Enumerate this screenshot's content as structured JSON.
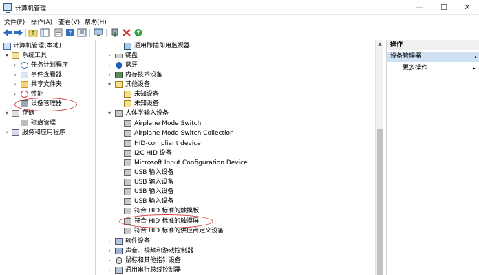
{
  "window": {
    "title": "计算机管理",
    "minimize_glyph": "—",
    "maximize_glyph": "☐",
    "close_glyph": "✕"
  },
  "menu": [
    "文件(F)",
    "操作(A)",
    "查看(V)",
    "帮助(H)"
  ],
  "toolbar_icons": [
    "back-icon",
    "forward-icon",
    "up-folder-icon",
    "show-hide-tree-icon",
    "properties-icon",
    "help-icon",
    "help-book-icon",
    "monitor-icon",
    "update-driver-icon",
    "delete-icon",
    "enable-device-icon"
  ],
  "left_tree": [
    {
      "label": "计算机管理(本地)",
      "icon": "computer-icon",
      "arrow": "",
      "indent": 0
    },
    {
      "label": "系统工具",
      "icon": "tools-icon",
      "arrow": "▾",
      "indent": 1
    },
    {
      "label": "任务计划程序",
      "icon": "clock-icon",
      "arrow": "›",
      "indent": 2
    },
    {
      "label": "事件查看器",
      "icon": "log-icon",
      "arrow": "›",
      "indent": 2
    },
    {
      "label": "共享文件夹",
      "icon": "folder-icon",
      "arrow": "›",
      "indent": 2
    },
    {
      "label": "性能",
      "icon": "performance-icon",
      "arrow": "›",
      "indent": 2
    },
    {
      "label": "设备管理器",
      "icon": "device-manager-icon",
      "arrow": "",
      "indent": 2
    },
    {
      "label": "存储",
      "icon": "storage-icon",
      "arrow": "▾",
      "indent": 1
    },
    {
      "label": "磁盘管理",
      "icon": "disk-icon",
      "arrow": "",
      "indent": 2
    },
    {
      "label": "服务和应用程序",
      "icon": "services-icon",
      "arrow": "›",
      "indent": 1
    }
  ],
  "device_tree": [
    {
      "label": "通用即插即用监视器",
      "icon": "monitor-icon",
      "arrow": "",
      "level": 2
    },
    {
      "label": "键盘",
      "icon": "keyboard-icon",
      "arrow": "›",
      "level": 1
    },
    {
      "label": "蓝牙",
      "icon": "bluetooth-icon",
      "arrow": "›",
      "level": 1
    },
    {
      "label": "内存技术设备",
      "icon": "chip-icon",
      "arrow": "›",
      "level": 1
    },
    {
      "label": "其他设备",
      "icon": "unknown-device-icon",
      "arrow": "▾",
      "level": 1
    },
    {
      "label": "未知设备",
      "icon": "unknown-device-icon",
      "arrow": "",
      "level": 2
    },
    {
      "label": "未知设备",
      "icon": "unknown-device-icon",
      "arrow": "",
      "level": 2
    },
    {
      "label": "人体学输入设备",
      "icon": "hid-icon",
      "arrow": "▾",
      "level": 1
    },
    {
      "label": "Airplane Mode Switch",
      "icon": "hid-icon",
      "arrow": "",
      "level": 2
    },
    {
      "label": "Airplane Mode Switch Collection",
      "icon": "hid-icon",
      "arrow": "",
      "level": 2
    },
    {
      "label": "HID-compliant device",
      "icon": "hid-icon",
      "arrow": "",
      "level": 2
    },
    {
      "label": "I2C HID 设备",
      "icon": "hid-icon",
      "arrow": "",
      "level": 2
    },
    {
      "label": "Microsoft Input Configuration Device",
      "icon": "hid-icon",
      "arrow": "",
      "level": 2
    },
    {
      "label": "USB 输入设备",
      "icon": "hid-icon",
      "arrow": "",
      "level": 2
    },
    {
      "label": "USB 输入设备",
      "icon": "hid-icon",
      "arrow": "",
      "level": 2
    },
    {
      "label": "USB 输入设备",
      "icon": "hid-icon",
      "arrow": "",
      "level": 2
    },
    {
      "label": "USB 输入设备",
      "icon": "hid-icon",
      "arrow": "",
      "level": 2
    },
    {
      "label": "符合 HID 标准的触摸板",
      "icon": "hid-icon",
      "arrow": "",
      "level": 2
    },
    {
      "label": "符合 HID 标准的触摸屏",
      "icon": "hid-icon",
      "arrow": "",
      "level": 2
    },
    {
      "label": "符合 HID 标准的供应商定义设备",
      "icon": "hid-icon",
      "arrow": "",
      "level": 2
    },
    {
      "label": "软件设备",
      "icon": "software-device-icon",
      "arrow": "›",
      "level": 1
    },
    {
      "label": "声音、视频和游戏控制器",
      "icon": "sound-icon",
      "arrow": "›",
      "level": 1
    },
    {
      "label": "鼠标和其他指针设备",
      "icon": "mouse-icon",
      "arrow": "›",
      "level": 1
    },
    {
      "label": "通用串行总线控制器",
      "icon": "usb-icon",
      "arrow": "›",
      "level": 1
    }
  ],
  "actions": {
    "header": "操作",
    "section": "设备管理器",
    "section_arrow": "▴",
    "more": "更多操作",
    "more_arrow": "▸"
  },
  "colors": {
    "highlight_oval": "#d63a3a",
    "action_section_bg": "#cfe1f5"
  }
}
